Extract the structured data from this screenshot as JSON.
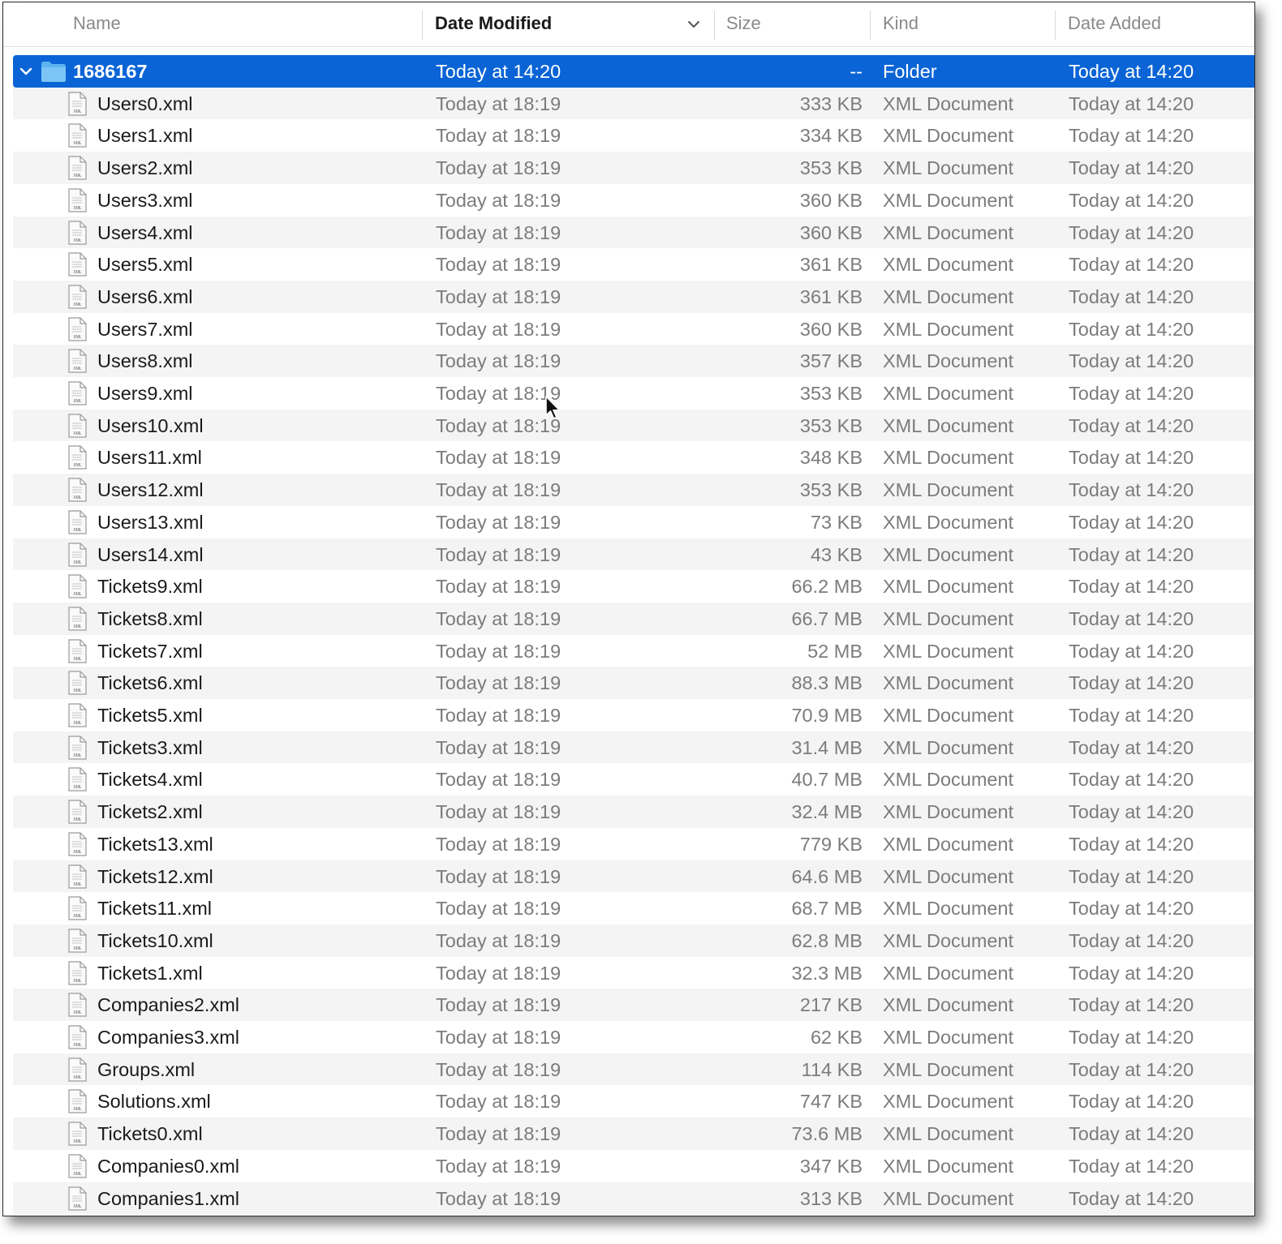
{
  "header": {
    "name": "Name",
    "date_modified": "Date Modified",
    "size": "Size",
    "kind": "Kind",
    "date_added": "Date Added"
  },
  "colors": {
    "selection": "#0a64d6",
    "folder": "#5fb4f0",
    "alt_row": "#f4f4f4"
  },
  "folder": {
    "name": "1686167",
    "date_modified": "Today at 14:20",
    "size": "--",
    "kind": "Folder",
    "date_added": "Today at 14:20",
    "expanded": true,
    "selected": true
  },
  "files": [
    {
      "name": "Users0.xml",
      "date_modified": "Today at 18:19",
      "size": "333 KB",
      "kind": "XML Document",
      "date_added": "Today at 14:20"
    },
    {
      "name": "Users1.xml",
      "date_modified": "Today at 18:19",
      "size": "334 KB",
      "kind": "XML Document",
      "date_added": "Today at 14:20"
    },
    {
      "name": "Users2.xml",
      "date_modified": "Today at 18:19",
      "size": "353 KB",
      "kind": "XML Document",
      "date_added": "Today at 14:20"
    },
    {
      "name": "Users3.xml",
      "date_modified": "Today at 18:19",
      "size": "360 KB",
      "kind": "XML Document",
      "date_added": "Today at 14:20"
    },
    {
      "name": "Users4.xml",
      "date_modified": "Today at 18:19",
      "size": "360 KB",
      "kind": "XML Document",
      "date_added": "Today at 14:20"
    },
    {
      "name": "Users5.xml",
      "date_modified": "Today at 18:19",
      "size": "361 KB",
      "kind": "XML Document",
      "date_added": "Today at 14:20"
    },
    {
      "name": "Users6.xml",
      "date_modified": "Today at 18:19",
      "size": "361 KB",
      "kind": "XML Document",
      "date_added": "Today at 14:20"
    },
    {
      "name": "Users7.xml",
      "date_modified": "Today at 18:19",
      "size": "360 KB",
      "kind": "XML Document",
      "date_added": "Today at 14:20"
    },
    {
      "name": "Users8.xml",
      "date_modified": "Today at 18:19",
      "size": "357 KB",
      "kind": "XML Document",
      "date_added": "Today at 14:20"
    },
    {
      "name": "Users9.xml",
      "date_modified": "Today at 18:19",
      "size": "353 KB",
      "kind": "XML Document",
      "date_added": "Today at 14:20"
    },
    {
      "name": "Users10.xml",
      "date_modified": "Today at 18:19",
      "size": "353 KB",
      "kind": "XML Document",
      "date_added": "Today at 14:20"
    },
    {
      "name": "Users11.xml",
      "date_modified": "Today at 18:19",
      "size": "348 KB",
      "kind": "XML Document",
      "date_added": "Today at 14:20"
    },
    {
      "name": "Users12.xml",
      "date_modified": "Today at 18:19",
      "size": "353 KB",
      "kind": "XML Document",
      "date_added": "Today at 14:20"
    },
    {
      "name": "Users13.xml",
      "date_modified": "Today at 18:19",
      "size": "73 KB",
      "kind": "XML Document",
      "date_added": "Today at 14:20"
    },
    {
      "name": "Users14.xml",
      "date_modified": "Today at 18:19",
      "size": "43 KB",
      "kind": "XML Document",
      "date_added": "Today at 14:20"
    },
    {
      "name": "Tickets9.xml",
      "date_modified": "Today at 18:19",
      "size": "66.2 MB",
      "kind": "XML Document",
      "date_added": "Today at 14:20"
    },
    {
      "name": "Tickets8.xml",
      "date_modified": "Today at 18:19",
      "size": "66.7 MB",
      "kind": "XML Document",
      "date_added": "Today at 14:20"
    },
    {
      "name": "Tickets7.xml",
      "date_modified": "Today at 18:19",
      "size": "52 MB",
      "kind": "XML Document",
      "date_added": "Today at 14:20"
    },
    {
      "name": "Tickets6.xml",
      "date_modified": "Today at 18:19",
      "size": "88.3 MB",
      "kind": "XML Document",
      "date_added": "Today at 14:20"
    },
    {
      "name": "Tickets5.xml",
      "date_modified": "Today at 18:19",
      "size": "70.9 MB",
      "kind": "XML Document",
      "date_added": "Today at 14:20"
    },
    {
      "name": "Tickets3.xml",
      "date_modified": "Today at 18:19",
      "size": "31.4 MB",
      "kind": "XML Document",
      "date_added": "Today at 14:20"
    },
    {
      "name": "Tickets4.xml",
      "date_modified": "Today at 18:19",
      "size": "40.7 MB",
      "kind": "XML Document",
      "date_added": "Today at 14:20"
    },
    {
      "name": "Tickets2.xml",
      "date_modified": "Today at 18:19",
      "size": "32.4 MB",
      "kind": "XML Document",
      "date_added": "Today at 14:20"
    },
    {
      "name": "Tickets13.xml",
      "date_modified": "Today at 18:19",
      "size": "779 KB",
      "kind": "XML Document",
      "date_added": "Today at 14:20"
    },
    {
      "name": "Tickets12.xml",
      "date_modified": "Today at 18:19",
      "size": "64.6 MB",
      "kind": "XML Document",
      "date_added": "Today at 14:20"
    },
    {
      "name": "Tickets11.xml",
      "date_modified": "Today at 18:19",
      "size": "68.7 MB",
      "kind": "XML Document",
      "date_added": "Today at 14:20"
    },
    {
      "name": "Tickets10.xml",
      "date_modified": "Today at 18:19",
      "size": "62.8 MB",
      "kind": "XML Document",
      "date_added": "Today at 14:20"
    },
    {
      "name": "Tickets1.xml",
      "date_modified": "Today at 18:19",
      "size": "32.3 MB",
      "kind": "XML Document",
      "date_added": "Today at 14:20"
    },
    {
      "name": "Companies2.xml",
      "date_modified": "Today at 18:19",
      "size": "217 KB",
      "kind": "XML Document",
      "date_added": "Today at 14:20"
    },
    {
      "name": "Companies3.xml",
      "date_modified": "Today at 18:19",
      "size": "62 KB",
      "kind": "XML Document",
      "date_added": "Today at 14:20"
    },
    {
      "name": "Groups.xml",
      "date_modified": "Today at 18:19",
      "size": "114 KB",
      "kind": "XML Document",
      "date_added": "Today at 14:20"
    },
    {
      "name": "Solutions.xml",
      "date_modified": "Today at 18:19",
      "size": "747 KB",
      "kind": "XML Document",
      "date_added": "Today at 14:20"
    },
    {
      "name": "Tickets0.xml",
      "date_modified": "Today at 18:19",
      "size": "73.6 MB",
      "kind": "XML Document",
      "date_added": "Today at 14:20"
    },
    {
      "name": "Companies0.xml",
      "date_modified": "Today at 18:19",
      "size": "347 KB",
      "kind": "XML Document",
      "date_added": "Today at 14:20"
    },
    {
      "name": "Companies1.xml",
      "date_modified": "Today at 18:19",
      "size": "313 KB",
      "kind": "XML Document",
      "date_added": "Today at 14:20"
    }
  ]
}
